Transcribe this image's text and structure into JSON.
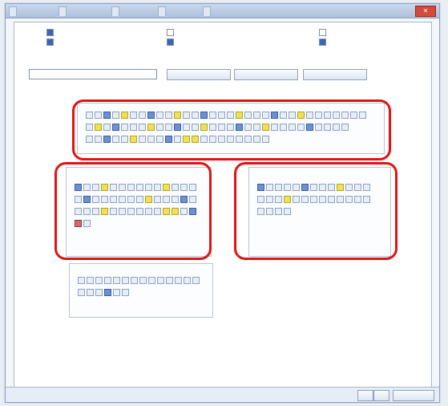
{
  "window": {
    "title": "",
    "tabs": [
      "",
      "",
      "",
      "",
      ""
    ]
  },
  "options": {
    "left1": "",
    "left2": "",
    "mid1": "",
    "mid2": "",
    "right1": "",
    "right2": ""
  },
  "search": {
    "label": "",
    "value": "",
    "buttons": [
      "",
      "",
      ""
    ]
  },
  "note": "",
  "groups": [
    {
      "name": "",
      "title": ""
    },
    {
      "name": "",
      "title": ""
    },
    {
      "name": "",
      "title": ""
    },
    {
      "name": "",
      "title": ""
    }
  ],
  "footer": {
    "buttons": [
      "",
      "",
      ""
    ]
  },
  "colors": {
    "accent": "#e31212",
    "window_bg": "#f3f6fa",
    "titlebar": "#aebfd8"
  }
}
